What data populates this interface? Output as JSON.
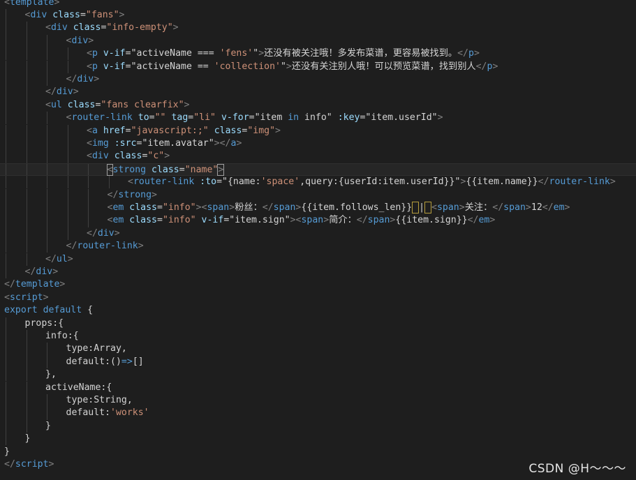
{
  "editor": {
    "lines": [
      {
        "indent": 0,
        "segs": [
          [
            "punct",
            "<"
          ],
          [
            "tag",
            "template"
          ],
          [
            "punct",
            ">"
          ]
        ]
      },
      {
        "indent": 1,
        "segs": [
          [
            "punct",
            "<"
          ],
          [
            "tag",
            "div"
          ],
          [
            "txt",
            " "
          ],
          [
            "attr",
            "class"
          ],
          [
            "txt",
            "="
          ],
          [
            "str",
            "\"fans\""
          ],
          [
            "punct",
            ">"
          ]
        ]
      },
      {
        "indent": 2,
        "segs": [
          [
            "punct",
            "<"
          ],
          [
            "tag",
            "div"
          ],
          [
            "txt",
            " "
          ],
          [
            "attr",
            "class"
          ],
          [
            "txt",
            "="
          ],
          [
            "str",
            "\"info-empty\""
          ],
          [
            "punct",
            ">"
          ]
        ]
      },
      {
        "indent": 3,
        "segs": [
          [
            "punct",
            "<"
          ],
          [
            "tag",
            "div"
          ],
          [
            "punct",
            ">"
          ]
        ]
      },
      {
        "indent": 4,
        "segs": [
          [
            "punct",
            "<"
          ],
          [
            "tag",
            "p"
          ],
          [
            "txt",
            " "
          ],
          [
            "attr",
            "v-if"
          ],
          [
            "txt",
            "=\"activeName === "
          ],
          [
            "str",
            "'fens'"
          ],
          [
            "txt",
            "\""
          ],
          [
            "punct",
            ">"
          ],
          [
            "txt",
            "还没有被关注哦！多发布菜谱，更容易被找到。"
          ],
          [
            "punct",
            "</"
          ],
          [
            "tag",
            "p"
          ],
          [
            "punct",
            ">"
          ]
        ]
      },
      {
        "indent": 4,
        "segs": [
          [
            "punct",
            "<"
          ],
          [
            "tag",
            "p"
          ],
          [
            "txt",
            " "
          ],
          [
            "attr",
            "v-if"
          ],
          [
            "txt",
            "=\"activeName == "
          ],
          [
            "str",
            "'collection'"
          ],
          [
            "txt",
            "\""
          ],
          [
            "punct",
            ">"
          ],
          [
            "txt",
            "还没有关注别人哦！可以预览菜谱，找到别人"
          ],
          [
            "punct",
            "</"
          ],
          [
            "tag",
            "p"
          ],
          [
            "punct",
            ">"
          ]
        ]
      },
      {
        "indent": 3,
        "segs": [
          [
            "punct",
            "</"
          ],
          [
            "tag",
            "div"
          ],
          [
            "punct",
            ">"
          ]
        ]
      },
      {
        "indent": 2,
        "segs": [
          [
            "punct",
            "</"
          ],
          [
            "tag",
            "div"
          ],
          [
            "punct",
            ">"
          ]
        ]
      },
      {
        "indent": 2,
        "segs": [
          [
            "punct",
            "<"
          ],
          [
            "tag",
            "ul"
          ],
          [
            "txt",
            " "
          ],
          [
            "attr",
            "class"
          ],
          [
            "txt",
            "="
          ],
          [
            "str",
            "\"fans clearfix\""
          ],
          [
            "punct",
            ">"
          ]
        ]
      },
      {
        "indent": 3,
        "segs": [
          [
            "punct",
            "<"
          ],
          [
            "tag",
            "router-link"
          ],
          [
            "txt",
            " "
          ],
          [
            "attr",
            "to"
          ],
          [
            "txt",
            "="
          ],
          [
            "str",
            "\"\""
          ],
          [
            "txt",
            " "
          ],
          [
            "attr",
            "tag"
          ],
          [
            "txt",
            "="
          ],
          [
            "str",
            "\"li\""
          ],
          [
            "txt",
            " "
          ],
          [
            "attr",
            "v-for"
          ],
          [
            "txt",
            "=\"item "
          ],
          [
            "kw",
            "in"
          ],
          [
            "txt",
            " info\" "
          ],
          [
            "attr",
            ":key"
          ],
          [
            "txt",
            "=\"item.userId\""
          ],
          [
            "punct",
            ">"
          ]
        ]
      },
      {
        "indent": 4,
        "segs": [
          [
            "punct",
            "<"
          ],
          [
            "tag",
            "a"
          ],
          [
            "txt",
            " "
          ],
          [
            "attr",
            "href"
          ],
          [
            "txt",
            "="
          ],
          [
            "str",
            "\"javascript:;\""
          ],
          [
            "txt",
            " "
          ],
          [
            "attr",
            "class"
          ],
          [
            "txt",
            "="
          ],
          [
            "str",
            "\"img\""
          ],
          [
            "punct",
            ">"
          ]
        ]
      },
      {
        "indent": 4,
        "segs": [
          [
            "punct",
            "<"
          ],
          [
            "tag",
            "img"
          ],
          [
            "txt",
            " "
          ],
          [
            "attr",
            ":src"
          ],
          [
            "txt",
            "=\"item.avatar\""
          ],
          [
            "punct",
            "></"
          ],
          [
            "tag",
            "a"
          ],
          [
            "punct",
            ">"
          ]
        ]
      },
      {
        "indent": 4,
        "segs": [
          [
            "punct",
            "<"
          ],
          [
            "tag",
            "div"
          ],
          [
            "txt",
            " "
          ],
          [
            "attr",
            "class"
          ],
          [
            "txt",
            "="
          ],
          [
            "str",
            "\"c\""
          ],
          [
            "punct",
            ">"
          ]
        ]
      },
      {
        "indent": 5,
        "cur": true,
        "segs": [
          [
            "punct",
            "<",
            "bm"
          ],
          [
            "tag",
            "strong"
          ],
          [
            "txt",
            " "
          ],
          [
            "attr",
            "class"
          ],
          [
            "txt",
            "="
          ],
          [
            "str",
            "\"name\""
          ],
          [
            "punct",
            ">",
            "bm"
          ]
        ]
      },
      {
        "indent": 6,
        "segs": [
          [
            "punct",
            "<"
          ],
          [
            "tag",
            "router-link"
          ],
          [
            "txt",
            " "
          ],
          [
            "attr",
            ":to"
          ],
          [
            "txt",
            "=\"{name:"
          ],
          [
            "str",
            "'space'"
          ],
          [
            "txt",
            ",query:{userId:item.userId}}\""
          ],
          [
            "punct",
            ">"
          ],
          [
            "txt",
            "{{item.name}}"
          ],
          [
            "punct",
            "</"
          ],
          [
            "tag",
            "router-link"
          ],
          [
            "punct",
            ">"
          ]
        ]
      },
      {
        "indent": 5,
        "segs": [
          [
            "punct",
            "</"
          ],
          [
            "tag",
            "strong"
          ],
          [
            "punct",
            ">"
          ]
        ]
      },
      {
        "indent": 5,
        "segs": [
          [
            "punct",
            "<"
          ],
          [
            "tag",
            "em"
          ],
          [
            "txt",
            " "
          ],
          [
            "attr",
            "class"
          ],
          [
            "txt",
            "="
          ],
          [
            "str",
            "\"info\""
          ],
          [
            "punct",
            "><"
          ],
          [
            "tag",
            "span"
          ],
          [
            "punct",
            ">"
          ],
          [
            "txt",
            "粉丝："
          ],
          [
            "punct",
            "</"
          ],
          [
            "tag",
            "span"
          ],
          [
            "punct",
            ">"
          ],
          [
            "txt",
            "{{item.follows_len}}"
          ],
          [
            "txt",
            " ",
            "sel"
          ],
          [
            "txt",
            "|"
          ],
          [
            "txt",
            " ",
            "sel"
          ],
          [
            "punct",
            "<"
          ],
          [
            "tag",
            "span"
          ],
          [
            "punct",
            ">"
          ],
          [
            "txt",
            "关注："
          ],
          [
            "punct",
            "</"
          ],
          [
            "tag",
            "span"
          ],
          [
            "punct",
            ">"
          ],
          [
            "txt",
            "12"
          ],
          [
            "punct",
            "</"
          ],
          [
            "tag",
            "em"
          ],
          [
            "punct",
            ">"
          ]
        ]
      },
      {
        "indent": 5,
        "segs": [
          [
            "punct",
            "<"
          ],
          [
            "tag",
            "em"
          ],
          [
            "txt",
            " "
          ],
          [
            "attr",
            "class"
          ],
          [
            "txt",
            "="
          ],
          [
            "str",
            "\"info\""
          ],
          [
            "txt",
            " "
          ],
          [
            "attr",
            "v-if"
          ],
          [
            "txt",
            "=\"item.sign\""
          ],
          [
            "punct",
            "><"
          ],
          [
            "tag",
            "span"
          ],
          [
            "punct",
            ">"
          ],
          [
            "txt",
            "简介："
          ],
          [
            "punct",
            "</"
          ],
          [
            "tag",
            "span"
          ],
          [
            "punct",
            ">"
          ],
          [
            "txt",
            "{{item.sign}}"
          ],
          [
            "punct",
            "</"
          ],
          [
            "tag",
            "em"
          ],
          [
            "punct",
            ">"
          ]
        ]
      },
      {
        "indent": 4,
        "segs": [
          [
            "punct",
            "</"
          ],
          [
            "tag",
            "div"
          ],
          [
            "punct",
            ">"
          ]
        ]
      },
      {
        "indent": 3,
        "segs": [
          [
            "punct",
            "</"
          ],
          [
            "tag",
            "router-link"
          ],
          [
            "punct",
            ">"
          ]
        ]
      },
      {
        "indent": 2,
        "segs": [
          [
            "punct",
            "</"
          ],
          [
            "tag",
            "ul"
          ],
          [
            "punct",
            ">"
          ]
        ]
      },
      {
        "indent": 1,
        "segs": [
          [
            "punct",
            "</"
          ],
          [
            "tag",
            "div"
          ],
          [
            "punct",
            ">"
          ]
        ]
      },
      {
        "indent": 0,
        "segs": [
          [
            "punct",
            "</"
          ],
          [
            "tag",
            "template"
          ],
          [
            "punct",
            ">"
          ]
        ]
      },
      {
        "indent": 0,
        "segs": [
          [
            "punct",
            "<"
          ],
          [
            "tag",
            "script"
          ],
          [
            "punct",
            ">"
          ]
        ]
      },
      {
        "indent": 0,
        "segs": [
          [
            "kw",
            "export"
          ],
          [
            "txt",
            " "
          ],
          [
            "kw",
            "default"
          ],
          [
            "txt",
            " {"
          ]
        ]
      },
      {
        "indent": 1,
        "segs": [
          [
            "txt",
            "props:{"
          ]
        ]
      },
      {
        "indent": 2,
        "segs": [
          [
            "txt",
            "info:{"
          ]
        ]
      },
      {
        "indent": 3,
        "segs": [
          [
            "txt",
            "type:Array,"
          ]
        ]
      },
      {
        "indent": 3,
        "segs": [
          [
            "txt",
            "default:"
          ],
          [
            "txt",
            "()"
          ],
          [
            "kw",
            "=>"
          ],
          [
            "txt",
            "[]"
          ]
        ]
      },
      {
        "indent": 2,
        "segs": [
          [
            "txt",
            "},"
          ]
        ]
      },
      {
        "indent": 2,
        "segs": [
          [
            "txt",
            "activeName:{"
          ]
        ]
      },
      {
        "indent": 3,
        "segs": [
          [
            "txt",
            "type:String,"
          ]
        ]
      },
      {
        "indent": 3,
        "segs": [
          [
            "txt",
            "default:"
          ],
          [
            "str",
            "'works'"
          ]
        ]
      },
      {
        "indent": 2,
        "segs": [
          [
            "txt",
            "}"
          ]
        ]
      },
      {
        "indent": 1,
        "segs": [
          [
            "txt",
            "}"
          ]
        ]
      },
      {
        "indent": 0,
        "segs": [
          [
            "txt",
            "}"
          ]
        ]
      },
      {
        "indent": 0,
        "segs": [
          [
            "punct",
            "</"
          ],
          [
            "tag",
            "script"
          ],
          [
            "punct",
            ">"
          ]
        ]
      }
    ]
  },
  "watermark": "CSDN @H～～～",
  "colors": {
    "background": "#1e1e1e",
    "tag": "#569cd6",
    "attribute": "#9cdcfe",
    "string": "#ce9178",
    "punctuation": "#808080",
    "text": "#d4d4d4"
  }
}
